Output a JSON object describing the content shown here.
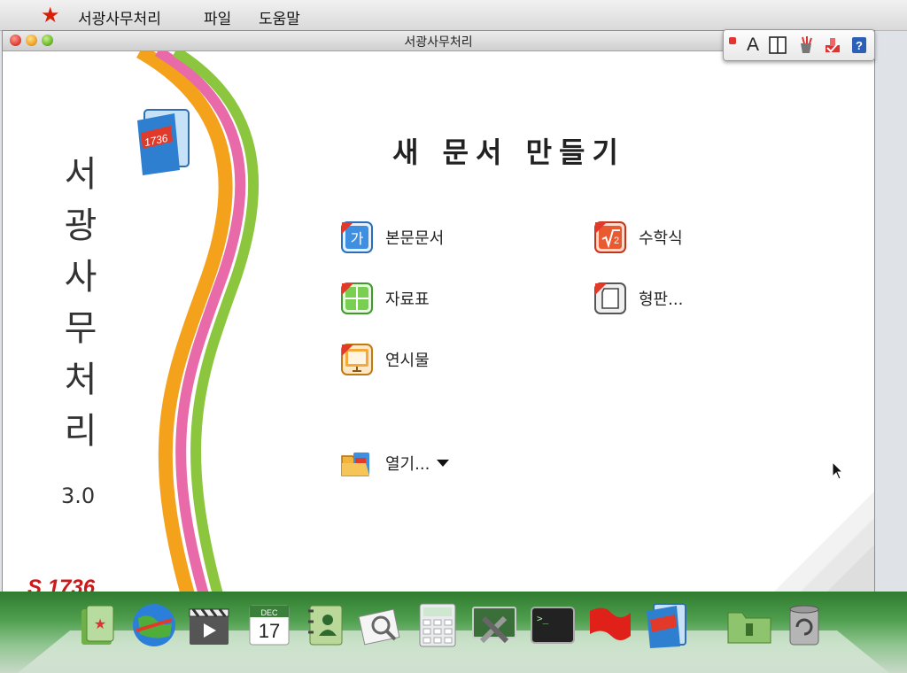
{
  "menubar": {
    "app_name": "서광사무처리",
    "menu_file": "파일",
    "menu_help": "도움말"
  },
  "window": {
    "title": "서광사무처리"
  },
  "toolbar": {
    "font_label": "A"
  },
  "sidebar": {
    "title_chars": [
      "서",
      "광",
      "사",
      "무",
      "처",
      "리"
    ],
    "version": "3.0",
    "brand": "S 1736"
  },
  "main": {
    "heading": "새 문서 만들기",
    "items": [
      {
        "label": "본문문서",
        "icon": "document-ga-icon"
      },
      {
        "label": "수학식",
        "icon": "math-sqrt-icon"
      },
      {
        "label": "자료표",
        "icon": "spreadsheet-icon"
      },
      {
        "label": "형판...",
        "icon": "template-icon"
      },
      {
        "label": "연시물",
        "icon": "presentation-icon"
      }
    ],
    "open_label": "열기..."
  },
  "dock": {
    "items": [
      "red-book-icon",
      "globe-icon",
      "video-clapper-icon",
      "calendar-icon",
      "address-book-icon",
      "image-viewer-icon",
      "calculator-icon",
      "system-tools-icon",
      "terminal-icon",
      "red-flag-icon",
      "office-suite-icon",
      "folder-icon",
      "trash-icon"
    ],
    "calendar_month": "DEC",
    "calendar_day": "17"
  },
  "colors": {
    "accent_red": "#d81e05",
    "dock_green": "#3f8f3f"
  }
}
